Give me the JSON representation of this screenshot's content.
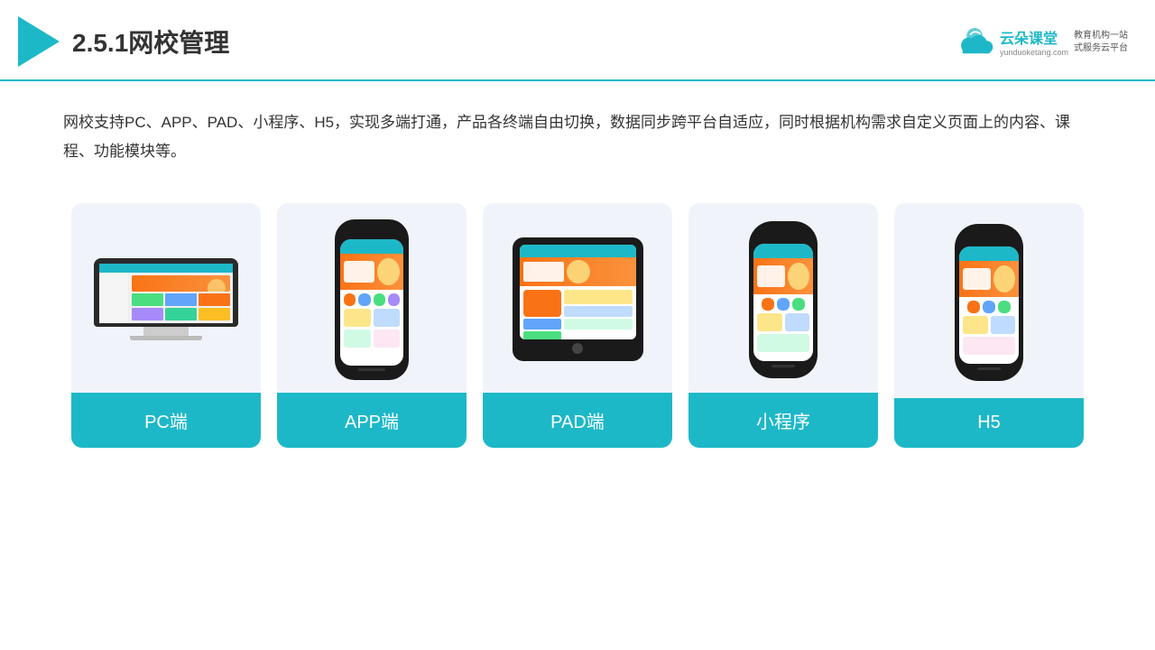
{
  "header": {
    "title": "2.5.1网校管理",
    "brand": {
      "name": "云朵课堂",
      "url": "yunduoketang.com",
      "tagline": "教育机构一站\n式服务云平台"
    }
  },
  "description": {
    "text": "网校支持PC、APP、PAD、小程序、H5，实现多端打通，产品各终端自由切换，数据同步跨平台自适应，同时根据机构需求自定义页面上的内容、课程、功能模块等。"
  },
  "cards": [
    {
      "id": "pc",
      "label": "PC端"
    },
    {
      "id": "app",
      "label": "APP端"
    },
    {
      "id": "pad",
      "label": "PAD端"
    },
    {
      "id": "miniapp",
      "label": "小程序"
    },
    {
      "id": "h5",
      "label": "H5"
    }
  ],
  "colors": {
    "accent": "#1db8c8",
    "card_bg": "#f0f4fa",
    "label_bg": "#1db8c8",
    "label_text": "#ffffff"
  }
}
